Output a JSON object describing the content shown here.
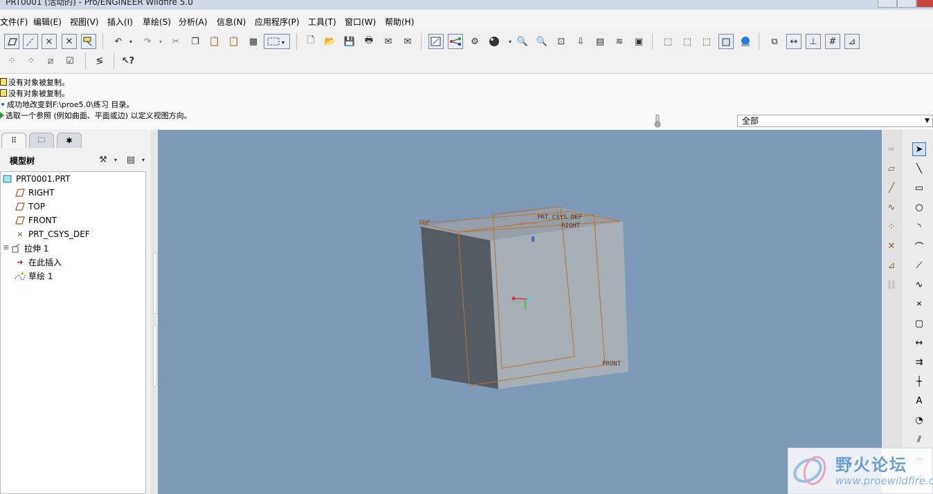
{
  "window": {
    "title": "PRT0001 (活动的) - Pro/ENGINEER Wildfire 5.0"
  },
  "menu": [
    "文件(F)",
    "编辑(E)",
    "视图(V)",
    "插入(I)",
    "草绘(S)",
    "分析(A)",
    "信息(N)",
    "应用程序(P)",
    "工具(T)",
    "窗口(W)",
    "帮助(H)"
  ],
  "messages": [
    "没有对象被复制。",
    "没有对象被复制。",
    "成功地改变到F:\\proe5.0\\练习 目录。",
    "选取一个参照 (例如曲面、平面或边) 以定义视图方向。"
  ],
  "filter": {
    "value": "全部"
  },
  "tree": {
    "title": "模型树",
    "items": [
      "PRT0001.PRT",
      "RIGHT",
      "TOP",
      "FRONT",
      "PRT_CSYS_DEF",
      "拉伸 1",
      "在此插入",
      "草绘 1"
    ]
  },
  "model": {
    "labels": {
      "top": "TOP",
      "csys": "PRT_CSYS_DEF",
      "right": "RIGHT",
      "front": "FRONT"
    },
    "colors": {
      "background": "#7e9ab8",
      "face_front": "#a6aeb6",
      "face_side": "#545b63",
      "face_top": "#96a0aa",
      "datum": "#c0712a"
    }
  },
  "watermark": {
    "name": "野火论坛",
    "url": "www.proewildfire.cn"
  }
}
